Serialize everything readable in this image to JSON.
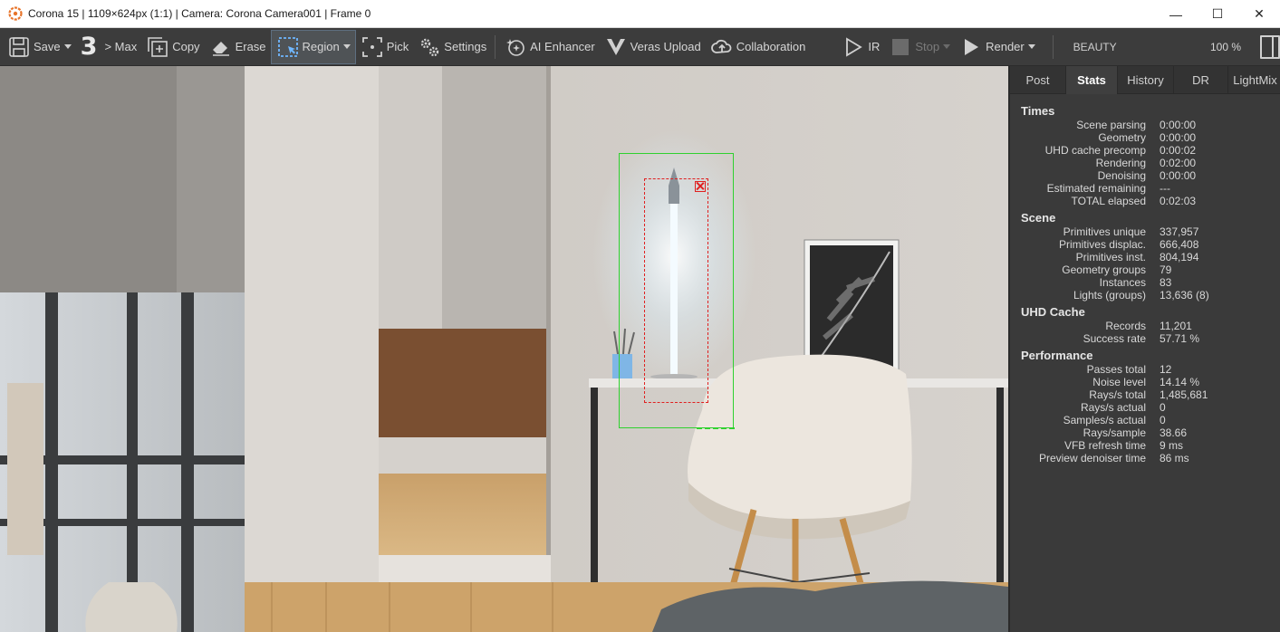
{
  "window": {
    "title": "Corona 15 | 1109×624px (1:1) | Camera: Corona Camera001 | Frame 0",
    "controls": {
      "minimize": "—",
      "maximize": "☐",
      "close": "✕"
    }
  },
  "toolbar": {
    "save": "Save",
    "max_number": "3",
    "max": "> Max",
    "copy": "Copy",
    "erase": "Erase",
    "region": "Region",
    "pick": "Pick",
    "settings": "Settings",
    "ai_enhancer": "AI Enhancer",
    "veras_upload": "Veras Upload",
    "collaboration": "Collaboration",
    "ir": "IR",
    "stop": "Stop",
    "render": "Render",
    "render_pass": "BEAUTY",
    "zoom": "100 %"
  },
  "panel": {
    "tabs": [
      {
        "label": "Post"
      },
      {
        "label": "Stats"
      },
      {
        "label": "History"
      },
      {
        "label": "DR"
      },
      {
        "label": "LightMix"
      }
    ],
    "active_tab": "Stats",
    "sections": {
      "times": {
        "title": "Times",
        "rows": [
          {
            "k": "Scene parsing",
            "v": "0:00:00"
          },
          {
            "k": "Geometry",
            "v": "0:00:00"
          },
          {
            "k": "UHD cache precomp",
            "v": "0:00:02"
          },
          {
            "k": "Rendering",
            "v": "0:02:00"
          },
          {
            "k": "Denoising",
            "v": "0:00:00"
          },
          {
            "k": "Estimated remaining",
            "v": "---"
          },
          {
            "k": "TOTAL elapsed",
            "v": "0:02:03"
          }
        ]
      },
      "scene": {
        "title": "Scene",
        "rows": [
          {
            "k": "Primitives unique",
            "v": "337,957"
          },
          {
            "k": "Primitives displac.",
            "v": "666,408"
          },
          {
            "k": "Primitives inst.",
            "v": "804,194"
          },
          {
            "k": "Geometry groups",
            "v": "79"
          },
          {
            "k": "Instances",
            "v": "83"
          },
          {
            "k": "Lights (groups)",
            "v": "13,636 (8)"
          }
        ]
      },
      "uhd": {
        "title": "UHD Cache",
        "rows": [
          {
            "k": "Records",
            "v": "11,201"
          },
          {
            "k": "Success rate",
            "v": "57.71 %"
          }
        ]
      },
      "performance": {
        "title": "Performance",
        "rows": [
          {
            "k": "Passes total",
            "v": "12"
          },
          {
            "k": "Noise level",
            "v": "14.14 %"
          },
          {
            "k": "Rays/s total",
            "v": "1,485,681"
          },
          {
            "k": "Rays/s actual",
            "v": "0"
          },
          {
            "k": "Samples/s actual",
            "v": "0"
          },
          {
            "k": "Rays/sample",
            "v": "38.66"
          },
          {
            "k": "VFB refresh time",
            "v": "9 ms"
          },
          {
            "k": "Preview denoiser time",
            "v": "86 ms"
          }
        ]
      }
    }
  },
  "colors": {
    "region_outer": "#2fd12f",
    "region_inner": "#e02020",
    "accent_logo": "#e8742a"
  }
}
